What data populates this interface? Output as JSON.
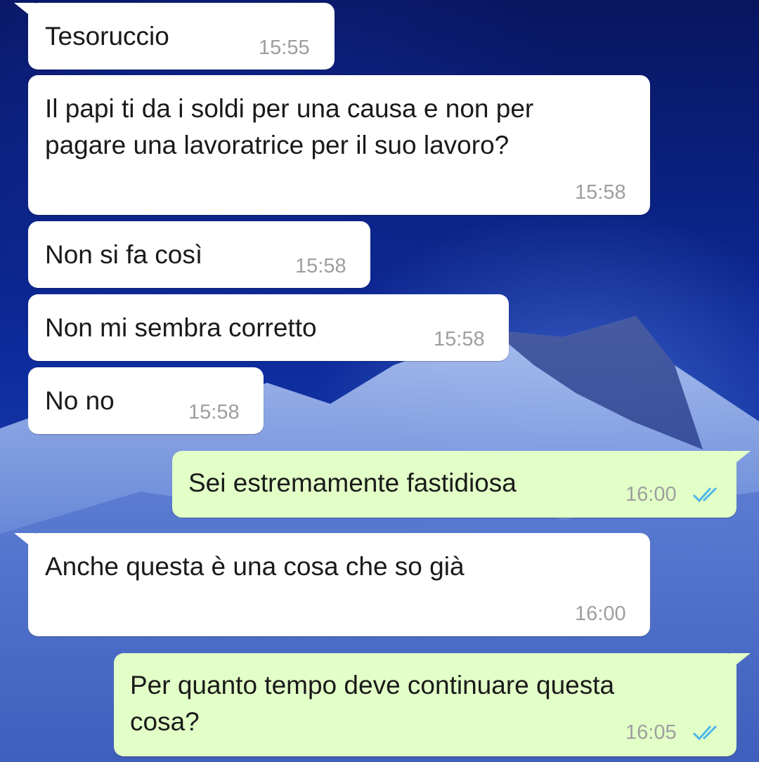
{
  "conversation": {
    "messages": [
      {
        "direction": "incoming",
        "text": "Tesoruccio",
        "time": "15:55"
      },
      {
        "direction": "incoming",
        "text_lines": [
          "Il papi ti da i soldi per una causa e non per",
          "pagare una lavoratrice per il suo lavoro?"
        ],
        "time": "15:58"
      },
      {
        "direction": "incoming",
        "text": "Non si fa così",
        "time": "15:58"
      },
      {
        "direction": "incoming",
        "text": "Non mi sembra corretto",
        "time": "15:58"
      },
      {
        "direction": "incoming",
        "text": "No no",
        "time": "15:58"
      },
      {
        "direction": "outgoing",
        "text": "Sei estremamente fastidiosa",
        "time": "16:00",
        "status_icon": "double-check-read-icon"
      },
      {
        "direction": "incoming",
        "text": "Anche questa è una cosa che so già",
        "time": "16:00"
      },
      {
        "direction": "outgoing",
        "text_lines": [
          "Per quanto tempo deve continuare questa",
          "cosa?"
        ],
        "time": "16:05",
        "status_icon": "double-check-read-icon"
      }
    ]
  },
  "colors": {
    "incoming_bubble": "#ffffff",
    "outgoing_bubble": "#e2ffc7",
    "read_tick": "#4fb6ec",
    "timestamp": "#9e9e9e"
  }
}
